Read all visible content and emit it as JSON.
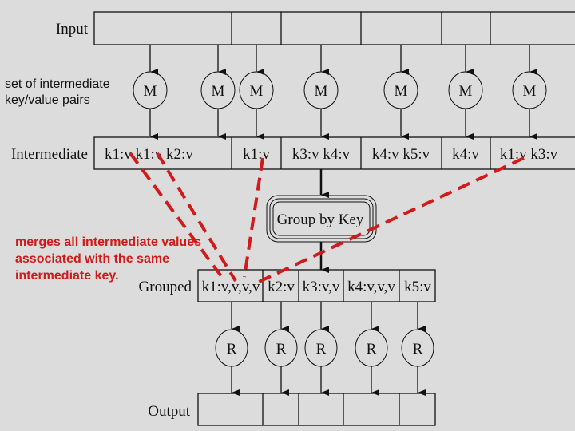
{
  "rows": {
    "input_label": "Input",
    "intermediate_label": "Intermediate",
    "grouped_label": "Grouped",
    "output_label": "Output"
  },
  "mapper_label": "M",
  "reducer_label": "R",
  "mapper_count": 7,
  "reducer_count": 5,
  "input_cells": [
    "",
    "",
    "",
    "",
    "",
    ""
  ],
  "intermediate_cells": [
    "k1:v k1:v k2:v",
    "k1:v",
    "k3:v k4:v",
    "k4:v k5:v",
    "k4:v",
    "k1:v k3:v"
  ],
  "group_box_label": "Group by Key",
  "grouped_cells": [
    "k1:v,v,v,v",
    "k2:v",
    "k3:v,v",
    "k4:v,v,v",
    "k5:v"
  ],
  "output_cells": [
    "",
    "",
    "",
    "",
    ""
  ],
  "annotations": {
    "intermediate_note_line1": "set of intermediate",
    "intermediate_note_line2": "key/value pairs",
    "merge_note_line1": "merges all intermediate values",
    "merge_note_line2": "associated with the same",
    "merge_note_line3": "intermediate key."
  },
  "colors": {
    "background": "#dcdcdc",
    "highlight": "#d11a1a",
    "ink": "#111111"
  }
}
